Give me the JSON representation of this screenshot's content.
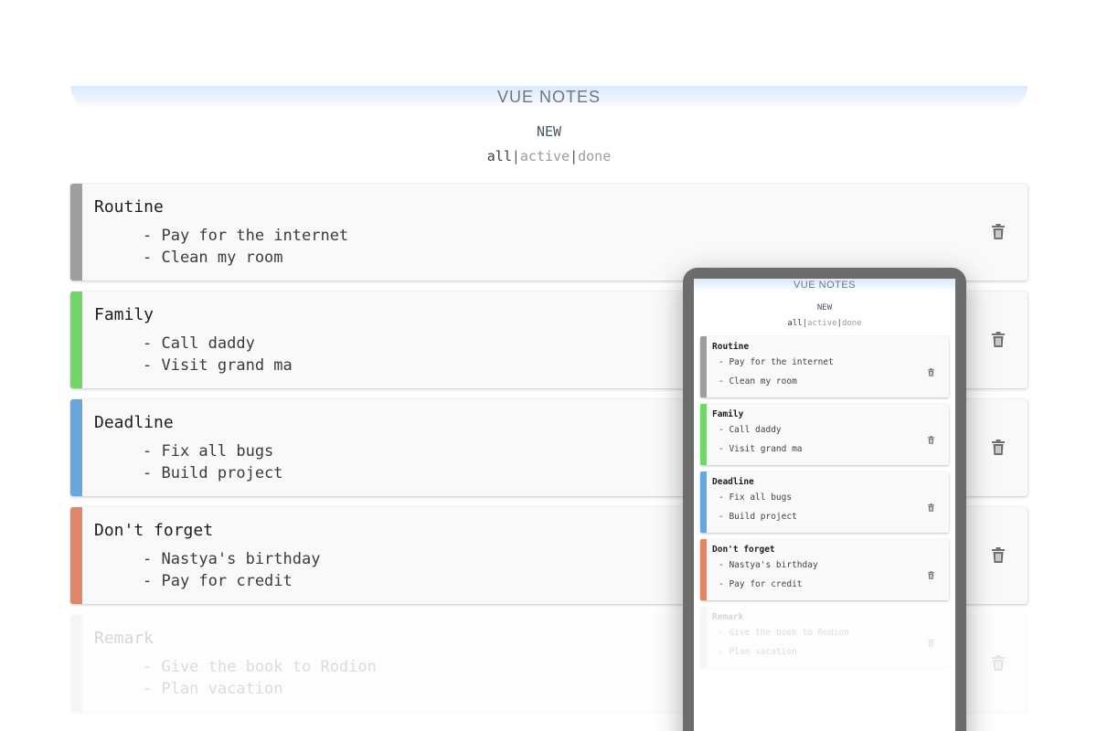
{
  "app": {
    "title": "VUE NOTES",
    "new_label": "NEW",
    "filters": {
      "all": "all",
      "active": "active",
      "done": "done",
      "separator": "|"
    },
    "selected_filter": "all"
  },
  "notes": [
    {
      "title": "Routine",
      "color": "#9e9e9e",
      "tasks": [
        "- Pay for the internet",
        "- Clean my room"
      ],
      "done": false
    },
    {
      "title": "Family",
      "color": "#72d66b",
      "tasks": [
        "- Call daddy",
        "- Visit grand ma"
      ],
      "done": false
    },
    {
      "title": "Deadline",
      "color": "#6aa6db",
      "tasks": [
        "- Fix all bugs",
        "- Build project"
      ],
      "done": false
    },
    {
      "title": "Don't forget",
      "color": "#de876c",
      "tasks": [
        "- Nastya's birthday",
        "- Pay for credit"
      ],
      "done": false
    },
    {
      "title": "Remark",
      "color": "#cfcfcf",
      "tasks": [
        "- Give the book to Rodion",
        "- Plan vacation"
      ],
      "done": true
    }
  ],
  "icons": {
    "delete": "trash-icon"
  },
  "colors": {
    "header_gradient": "#dbe9fb",
    "phone_frame": "#6c6c6c",
    "note_bg": "#f9f9f9"
  }
}
